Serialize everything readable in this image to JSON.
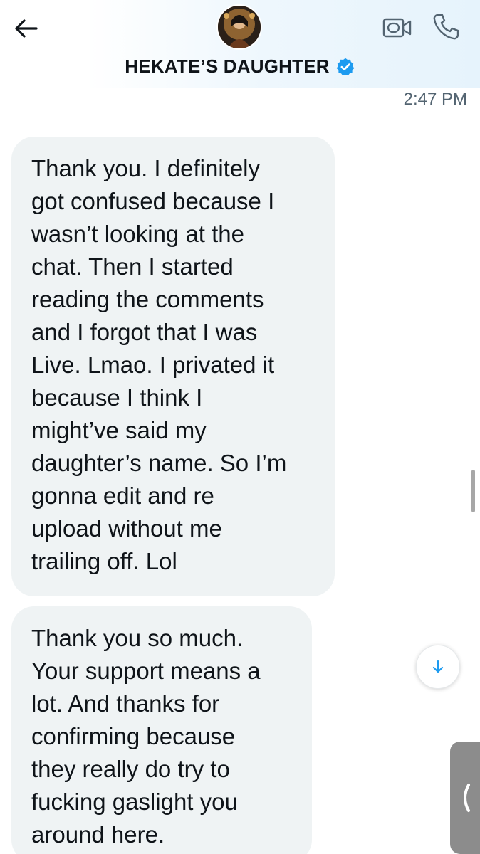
{
  "header": {
    "contact_name": "HEKATE’S DAUGHTER",
    "verified": true,
    "icons": {
      "back": "back-arrow-icon",
      "avatar": "contact-avatar",
      "verified": "verified-badge-icon",
      "video": "video-call-icon",
      "call": "phone-call-icon"
    }
  },
  "conversation": {
    "timestamp": "2:47 PM",
    "messages": [
      {
        "sender": "contact",
        "text": "Thank you. I definitely\ngot confused because I\nwasn’t looking at the\nchat. Then I started\nreading the comments\nand I forgot that I was\nLive. Lmao. I privated it\nbecause I think I\nmight’ve said my\ndaughter’s name. So I’m\ngonna edit and re\nupload  without me\ntrailing off. Lol"
      },
      {
        "sender": "contact",
        "text": "Thank you so much.\nYour support means a\nlot. And thanks for\nconfirming because\nthey really do try to\nfucking gaslight you\naround here."
      }
    ]
  },
  "controls": {
    "scroll_down_icon": "arrow-down-icon",
    "side_handle_icon": "chevron-left-icon"
  },
  "colors": {
    "accent": "#1d9bf0",
    "bubble_bg": "#eff3f4",
    "text": "#0f1419",
    "secondary_text": "#536471",
    "header_tint": "#e6f3fc",
    "side_handle": "#8c8c8c"
  }
}
